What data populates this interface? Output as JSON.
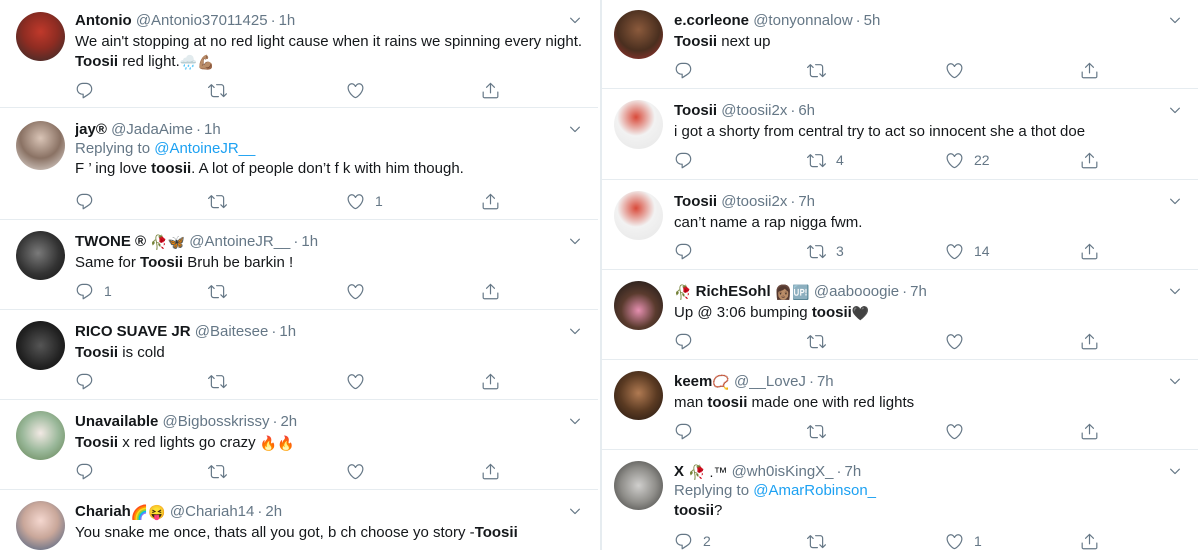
{
  "colors": {
    "text": "#14171a",
    "secondary": "#657786",
    "link": "#1da1f2",
    "divider": "#e6ecf0"
  },
  "left_tweets": [
    {
      "name": "Antonio",
      "handle": "@Antonio37011425",
      "time": "1h",
      "reply_prefix": "",
      "reply_to": "",
      "text_pre": "We ain't stopping at no red light cause when it rains we spinning every night.",
      "text_line2_bold": "Toosii",
      "text_line2_rest": " red light.",
      "emoji_after": "🌧️💪🏽",
      "counts": {
        "reply": "",
        "retweet": "",
        "like": ""
      }
    },
    {
      "name": "jay®",
      "handle": "@JadaAime",
      "time": "1h",
      "reply_prefix": "Replying to ",
      "reply_to": "@AntoineJR__",
      "text_a": "F  ’ ing love ",
      "text_bold": "toosii",
      "text_b": ". A lot of people don’t f  k with him though.",
      "counts": {
        "reply": "",
        "retweet": "",
        "like": "1"
      }
    },
    {
      "name": "TWONE ®",
      "name_emoji": "🥀🦋",
      "handle": "@AntoineJR__",
      "time": "1h",
      "text_bold": "Toosii",
      "text_a": "Same for ",
      "text_b": " Bruh be barkin !",
      "counts": {
        "reply": "1",
        "retweet": "",
        "like": ""
      }
    },
    {
      "name": "RICO SUAVE JR",
      "handle": "@Baitesee",
      "time": "1h",
      "text_bold": "Toosii",
      "text_b": " is cold",
      "counts": {
        "reply": "",
        "retweet": "",
        "like": ""
      }
    },
    {
      "name": "Unavailable",
      "handle": "@Bigbosskrissy",
      "time": "2h",
      "text_bold": "Toosii",
      "text_b": " x red lights go crazy ",
      "emoji_after": "🔥🔥",
      "counts": {
        "reply": "",
        "retweet": "",
        "like": ""
      }
    },
    {
      "name": "Chariah",
      "name_emoji": "🌈😝",
      "handle": "@Chariah14",
      "time": "2h",
      "text_a": "You snake me once, thats all you got, b  ch choose yo story -",
      "text_bold": "Toosii",
      "counts": {
        "reply": "",
        "retweet": "",
        "like": ""
      }
    }
  ],
  "right_tweets": [
    {
      "name": "e.corleone",
      "handle": "@tonyonnalow",
      "time": "5h",
      "text_bold": "Toosii",
      "text_b": " next up",
      "counts": {
        "reply": "",
        "retweet": "",
        "like": ""
      }
    },
    {
      "name": "Toosii",
      "handle": "@toosii2x",
      "time": "6h",
      "text_b": "i got a shorty from central try to act so innocent she a thot doe",
      "counts": {
        "reply": "",
        "retweet": "4",
        "like": "22"
      }
    },
    {
      "name": "Toosii",
      "handle": "@toosii2x",
      "time": "7h",
      "text_b": "can’t name a rap nigga fwm.",
      "counts": {
        "reply": "",
        "retweet": "3",
        "like": "14"
      }
    },
    {
      "name_prefix_emoji": "🥀",
      "name": "RichESohl",
      "name_emoji": "👩🏽🆙",
      "handle": "@aabooogie",
      "time": "7h",
      "text_a": "Up @ 3:06 bumping ",
      "text_bold": "toosii",
      "emoji_after": " 🖤",
      "counts": {
        "reply": "",
        "retweet": "",
        "like": ""
      }
    },
    {
      "name": "keem",
      "name_emoji": "📿",
      "handle": "@__LoveJ",
      "time": "7h",
      "text_a": "man ",
      "text_bold": "toosii",
      "text_b": " made one with red lights",
      "counts": {
        "reply": "",
        "retweet": "",
        "like": ""
      }
    },
    {
      "name": "X",
      "name_emoji": "🥀 .™",
      "handle": "@wh0isKingX_",
      "time": "7h",
      "reply_prefix": "Replying to ",
      "reply_to": "@AmarRobinson_",
      "text_bold": "toosii",
      "text_b": "?",
      "counts": {
        "reply": "2",
        "retweet": "",
        "like": "1"
      }
    }
  ]
}
